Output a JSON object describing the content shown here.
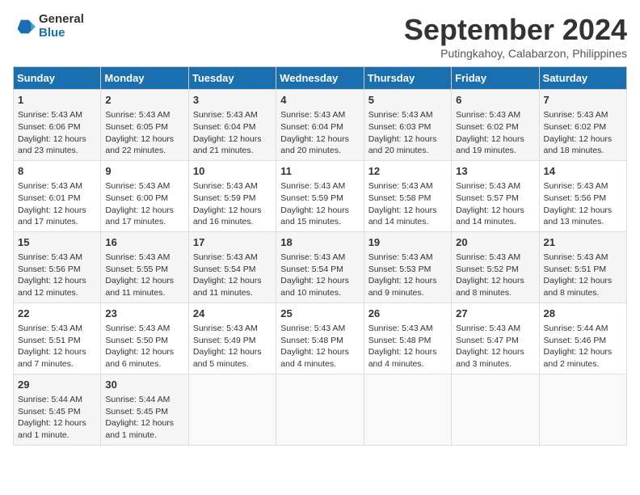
{
  "header": {
    "logo_general": "General",
    "logo_blue": "Blue",
    "month_title": "September 2024",
    "location": "Putingkahoy, Calabarzon, Philippines"
  },
  "weekdays": [
    "Sunday",
    "Monday",
    "Tuesday",
    "Wednesday",
    "Thursday",
    "Friday",
    "Saturday"
  ],
  "weeks": [
    [
      {
        "day": "1",
        "sunrise": "Sunrise: 5:43 AM",
        "sunset": "Sunset: 6:06 PM",
        "daylight": "Daylight: 12 hours and 23 minutes."
      },
      {
        "day": "2",
        "sunrise": "Sunrise: 5:43 AM",
        "sunset": "Sunset: 6:05 PM",
        "daylight": "Daylight: 12 hours and 22 minutes."
      },
      {
        "day": "3",
        "sunrise": "Sunrise: 5:43 AM",
        "sunset": "Sunset: 6:04 PM",
        "daylight": "Daylight: 12 hours and 21 minutes."
      },
      {
        "day": "4",
        "sunrise": "Sunrise: 5:43 AM",
        "sunset": "Sunset: 6:04 PM",
        "daylight": "Daylight: 12 hours and 20 minutes."
      },
      {
        "day": "5",
        "sunrise": "Sunrise: 5:43 AM",
        "sunset": "Sunset: 6:03 PM",
        "daylight": "Daylight: 12 hours and 20 minutes."
      },
      {
        "day": "6",
        "sunrise": "Sunrise: 5:43 AM",
        "sunset": "Sunset: 6:02 PM",
        "daylight": "Daylight: 12 hours and 19 minutes."
      },
      {
        "day": "7",
        "sunrise": "Sunrise: 5:43 AM",
        "sunset": "Sunset: 6:02 PM",
        "daylight": "Daylight: 12 hours and 18 minutes."
      }
    ],
    [
      {
        "day": "8",
        "sunrise": "Sunrise: 5:43 AM",
        "sunset": "Sunset: 6:01 PM",
        "daylight": "Daylight: 12 hours and 17 minutes."
      },
      {
        "day": "9",
        "sunrise": "Sunrise: 5:43 AM",
        "sunset": "Sunset: 6:00 PM",
        "daylight": "Daylight: 12 hours and 17 minutes."
      },
      {
        "day": "10",
        "sunrise": "Sunrise: 5:43 AM",
        "sunset": "Sunset: 5:59 PM",
        "daylight": "Daylight: 12 hours and 16 minutes."
      },
      {
        "day": "11",
        "sunrise": "Sunrise: 5:43 AM",
        "sunset": "Sunset: 5:59 PM",
        "daylight": "Daylight: 12 hours and 15 minutes."
      },
      {
        "day": "12",
        "sunrise": "Sunrise: 5:43 AM",
        "sunset": "Sunset: 5:58 PM",
        "daylight": "Daylight: 12 hours and 14 minutes."
      },
      {
        "day": "13",
        "sunrise": "Sunrise: 5:43 AM",
        "sunset": "Sunset: 5:57 PM",
        "daylight": "Daylight: 12 hours and 14 minutes."
      },
      {
        "day": "14",
        "sunrise": "Sunrise: 5:43 AM",
        "sunset": "Sunset: 5:56 PM",
        "daylight": "Daylight: 12 hours and 13 minutes."
      }
    ],
    [
      {
        "day": "15",
        "sunrise": "Sunrise: 5:43 AM",
        "sunset": "Sunset: 5:56 PM",
        "daylight": "Daylight: 12 hours and 12 minutes."
      },
      {
        "day": "16",
        "sunrise": "Sunrise: 5:43 AM",
        "sunset": "Sunset: 5:55 PM",
        "daylight": "Daylight: 12 hours and 11 minutes."
      },
      {
        "day": "17",
        "sunrise": "Sunrise: 5:43 AM",
        "sunset": "Sunset: 5:54 PM",
        "daylight": "Daylight: 12 hours and 11 minutes."
      },
      {
        "day": "18",
        "sunrise": "Sunrise: 5:43 AM",
        "sunset": "Sunset: 5:54 PM",
        "daylight": "Daylight: 12 hours and 10 minutes."
      },
      {
        "day": "19",
        "sunrise": "Sunrise: 5:43 AM",
        "sunset": "Sunset: 5:53 PM",
        "daylight": "Daylight: 12 hours and 9 minutes."
      },
      {
        "day": "20",
        "sunrise": "Sunrise: 5:43 AM",
        "sunset": "Sunset: 5:52 PM",
        "daylight": "Daylight: 12 hours and 8 minutes."
      },
      {
        "day": "21",
        "sunrise": "Sunrise: 5:43 AM",
        "sunset": "Sunset: 5:51 PM",
        "daylight": "Daylight: 12 hours and 8 minutes."
      }
    ],
    [
      {
        "day": "22",
        "sunrise": "Sunrise: 5:43 AM",
        "sunset": "Sunset: 5:51 PM",
        "daylight": "Daylight: 12 hours and 7 minutes."
      },
      {
        "day": "23",
        "sunrise": "Sunrise: 5:43 AM",
        "sunset": "Sunset: 5:50 PM",
        "daylight": "Daylight: 12 hours and 6 minutes."
      },
      {
        "day": "24",
        "sunrise": "Sunrise: 5:43 AM",
        "sunset": "Sunset: 5:49 PM",
        "daylight": "Daylight: 12 hours and 5 minutes."
      },
      {
        "day": "25",
        "sunrise": "Sunrise: 5:43 AM",
        "sunset": "Sunset: 5:48 PM",
        "daylight": "Daylight: 12 hours and 4 minutes."
      },
      {
        "day": "26",
        "sunrise": "Sunrise: 5:43 AM",
        "sunset": "Sunset: 5:48 PM",
        "daylight": "Daylight: 12 hours and 4 minutes."
      },
      {
        "day": "27",
        "sunrise": "Sunrise: 5:43 AM",
        "sunset": "Sunset: 5:47 PM",
        "daylight": "Daylight: 12 hours and 3 minutes."
      },
      {
        "day": "28",
        "sunrise": "Sunrise: 5:44 AM",
        "sunset": "Sunset: 5:46 PM",
        "daylight": "Daylight: 12 hours and 2 minutes."
      }
    ],
    [
      {
        "day": "29",
        "sunrise": "Sunrise: 5:44 AM",
        "sunset": "Sunset: 5:45 PM",
        "daylight": "Daylight: 12 hours and 1 minute."
      },
      {
        "day": "30",
        "sunrise": "Sunrise: 5:44 AM",
        "sunset": "Sunset: 5:45 PM",
        "daylight": "Daylight: 12 hours and 1 minute."
      },
      null,
      null,
      null,
      null,
      null
    ]
  ]
}
